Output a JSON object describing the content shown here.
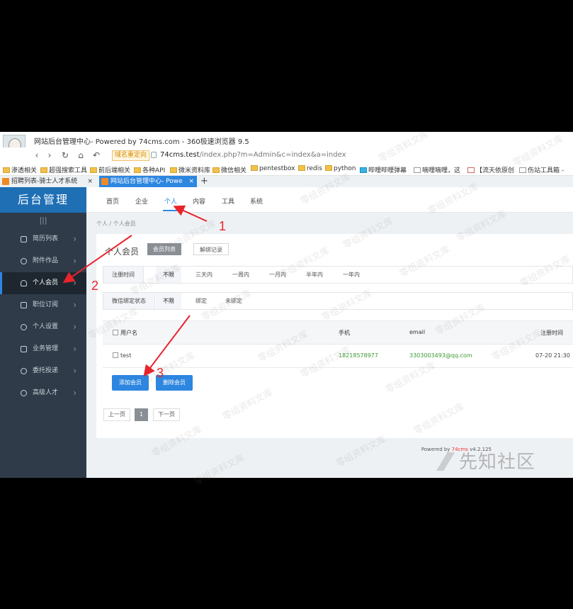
{
  "browser": {
    "window_title": "网站后台管理中心- Powered by 74cms.com - 360极速浏览器 9.5",
    "redirect_badge": "域名重定向",
    "url_host": "74cms.test",
    "url_path": "/index.php?m=Admin&c=index&a=index",
    "bookmarks": [
      "渗透相关",
      "超强搜索工具",
      "前后端相关",
      "各种API",
      "微米资料库",
      "微信相关",
      "pentestbox",
      "redis",
      "python",
      "哔哩哔哩弹幕",
      "嘀哩嘀哩，这",
      "【流天依原创",
      "伤站工具箱 -"
    ],
    "tabs": [
      {
        "label": "招聘列表-骑士人才系统",
        "close": "×"
      },
      {
        "label": "网站后台管理中心- Powe",
        "close": "×"
      }
    ],
    "new_tab": "+"
  },
  "sidebar": {
    "brand": "后台管理",
    "collapse": "|||",
    "items": [
      {
        "label": "简历列表",
        "icon": "resume-icon"
      },
      {
        "label": "附件作品",
        "icon": "paperclip-icon"
      },
      {
        "label": "个人会员",
        "icon": "person-icon",
        "active": true
      },
      {
        "label": "职位订阅",
        "icon": "rss-icon"
      },
      {
        "label": "个人设置",
        "icon": "gear-icon"
      },
      {
        "label": "业务管理",
        "icon": "briefcase-icon"
      },
      {
        "label": "委托投递",
        "icon": "send-icon"
      },
      {
        "label": "高级人才",
        "icon": "badge-icon"
      }
    ],
    "chevron": "›"
  },
  "topnav": [
    "首页",
    "企业",
    "个人",
    "内容",
    "工具",
    "系统"
  ],
  "breadcrumb": "个人 / 个人会员",
  "panel": {
    "title": "个人会员",
    "tab_active": "会员列表",
    "tab_other": "解绑记录",
    "filter_reg": {
      "label": "注册时间",
      "options": [
        "不限",
        "三天内",
        "一周内",
        "一月内",
        "半年内",
        "一年内"
      ]
    },
    "filter_wx": {
      "label": "微信绑定状态",
      "options": [
        "不限",
        "绑定",
        "未绑定"
      ]
    },
    "table": {
      "headers": [
        "用户名",
        "手机",
        "email",
        "注册时间"
      ],
      "rows": [
        {
          "username": "test",
          "phone": "18218578977",
          "email": "3303003493@qq.com",
          "reg_time": "07-20 21:30"
        }
      ]
    },
    "add_button": "添加会员",
    "delete_button": "删除会员",
    "pager": {
      "prev": "上一页",
      "current": "1",
      "next": "下一页"
    }
  },
  "footer": {
    "prefix": "Powered by ",
    "brand": "74cms",
    "version": " v4.2.125"
  },
  "watermark": "零组资料文库",
  "site_mark": "先知社区",
  "annotations": {
    "n1": "1",
    "n2": "2",
    "n3": "3",
    "color": "#e8242b"
  }
}
